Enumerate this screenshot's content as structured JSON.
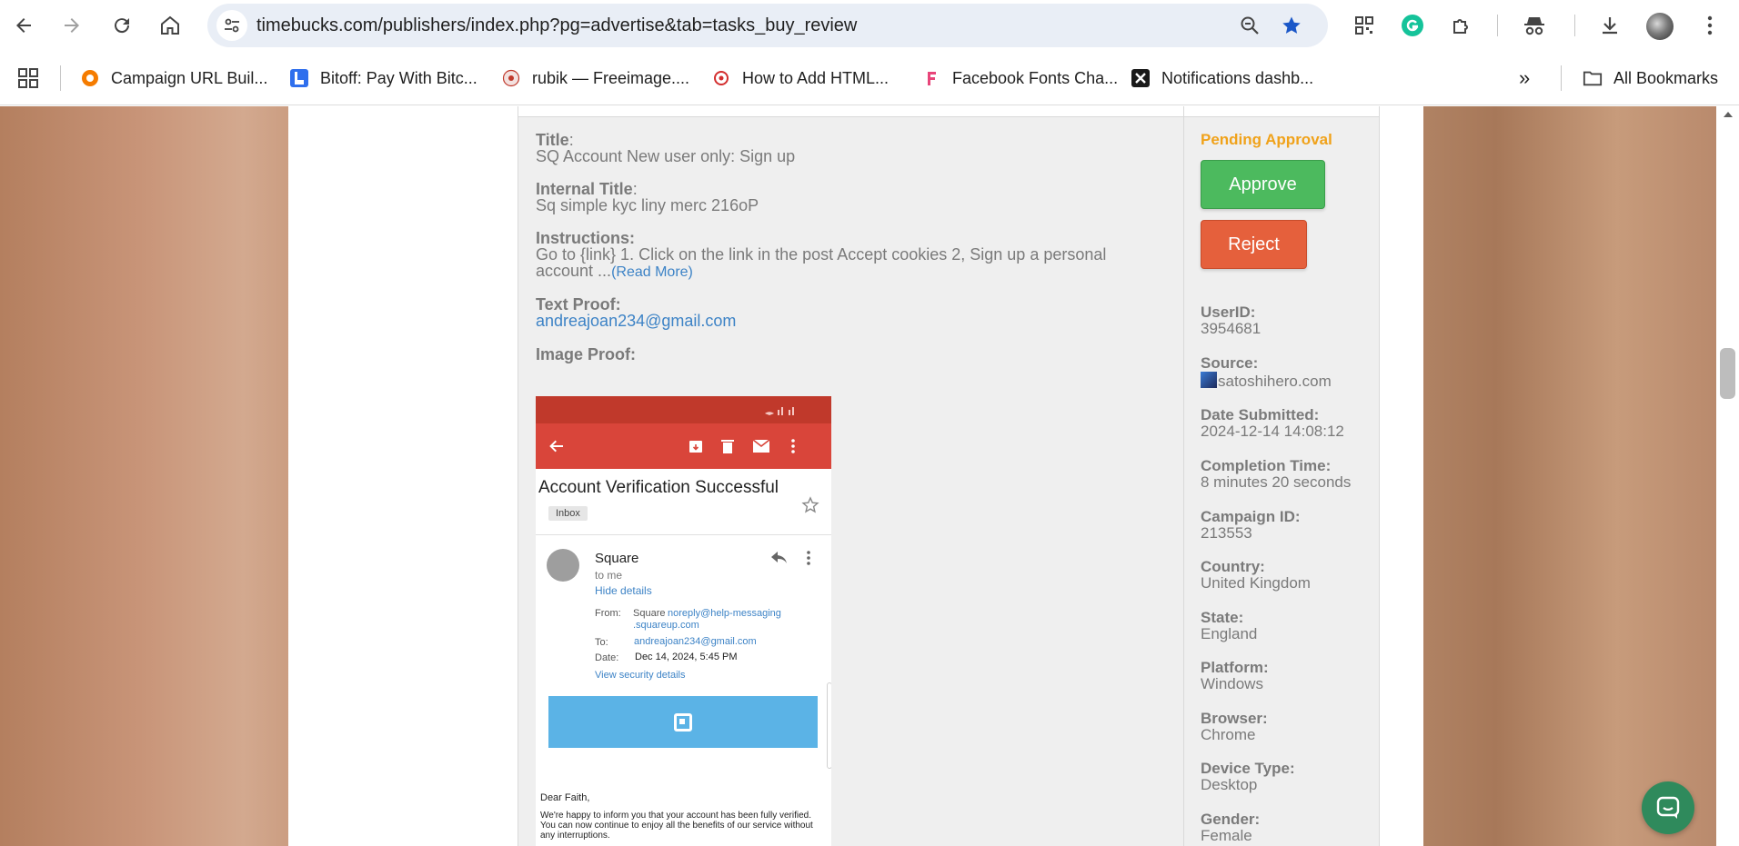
{
  "browser": {
    "url": "timebucks.com/publishers/index.php?pg=advertise&tab=tasks_buy_review",
    "bookmarks": [
      {
        "label": "Campaign URL Buil...",
        "icon": "campaign-url-builder-favicon"
      },
      {
        "label": "Bitoff: Pay With Bitc...",
        "icon": "bitoff-favicon"
      },
      {
        "label": "rubik — Freeimage....",
        "icon": "freeimage-favicon"
      },
      {
        "label": "How to Add HTML...",
        "icon": "html-guide-favicon"
      },
      {
        "label": "Facebook Fonts Cha...",
        "icon": "facebook-fonts-favicon"
      },
      {
        "label": "Notifications dashb...",
        "icon": "notifications-favicon"
      }
    ],
    "overflow": "»",
    "all_bookmarks": "All Bookmarks"
  },
  "task": {
    "title_label": "Title",
    "title": "SQ Account New user only: Sign up",
    "internal_title_label": "Internal Title",
    "internal_title": "Sq simple kyc liny merc 216oP",
    "instructions_label": "Instructions:",
    "instructions_line1": "Go to {link} 1. Click on the link in the post Accept cookies 2, Sign up a personal",
    "instructions_line2": "account ...",
    "read_more": "(Read More)",
    "text_proof_label": "Text Proof:",
    "text_proof": "andreajoan234@gmail.com",
    "image_proof_label": "Image Proof:"
  },
  "proof_image": {
    "subject": "Account Verification Successful",
    "folder": "Inbox",
    "sender": "Square",
    "to_me": "to me",
    "hide_details": "Hide details",
    "from_label": "From:",
    "from_name": "Square",
    "from_email_1": "noreply@help-messaging",
    "from_email_2": ".squareup.com",
    "to_label": "To:",
    "to_email": "andreajoan234@gmail.com",
    "date_label": "Date:",
    "date": "Dec 14, 2024, 5:45 PM",
    "security": "View security details",
    "greeting": "Dear Faith,",
    "body": "We're happy to inform you that your account has been fully verified. You can now continue to enjoy all the benefits of our service without any interruptions."
  },
  "review": {
    "status": "Pending Approval",
    "approve": "Approve",
    "reject": "Reject",
    "meta": [
      {
        "key": "UserID:",
        "value": "3954681"
      },
      {
        "key": "Source:",
        "value": "satoshihero.com"
      },
      {
        "key": "Date Submitted:",
        "value": "2024-12-14 14:08:12"
      },
      {
        "key": "Completion Time:",
        "value": "8 minutes 20 seconds"
      },
      {
        "key": "Campaign ID:",
        "value": "213553"
      },
      {
        "key": "Country:",
        "value": "United Kingdom"
      },
      {
        "key": "State:",
        "value": "England"
      },
      {
        "key": "Platform:",
        "value": "Windows"
      },
      {
        "key": "Browser:",
        "value": "Chrome"
      },
      {
        "key": "Device Type:",
        "value": "Desktop"
      },
      {
        "key": "Gender:",
        "value": "Female"
      }
    ]
  },
  "colors": {
    "pending": "#f0a21a",
    "approve": "#4cba5e",
    "reject": "#e5603c",
    "link": "#3d83c6"
  }
}
